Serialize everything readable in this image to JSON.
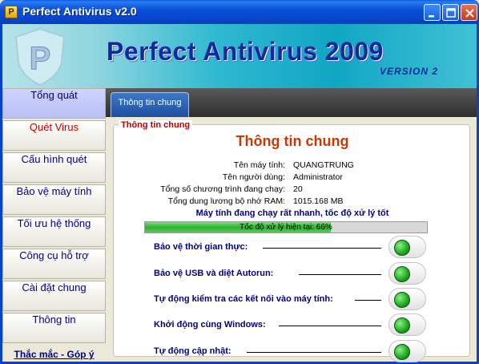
{
  "window": {
    "title": "Perfect Antivirus v2.0",
    "app_icon_letter": "P"
  },
  "banner": {
    "title": "Perfect Antivirus 2009",
    "version": "VERSION 2",
    "logo_letter": "P"
  },
  "sidebar": {
    "items": [
      {
        "label": "Tổng quát",
        "active": true
      },
      {
        "label": "Quét Virus"
      },
      {
        "label": "Cấu hình quét"
      },
      {
        "label": "Bảo vệ máy tính"
      },
      {
        "label": "Tối ưu hệ thống"
      },
      {
        "label": "Công cụ hỗ trợ"
      },
      {
        "label": "Cài đặt chung"
      },
      {
        "label": "Thông tin"
      }
    ],
    "link": "Thắc mắc - Góp ý"
  },
  "tabs": [
    {
      "label": "Thông tin chung",
      "active": true
    }
  ],
  "panel": {
    "legend": "Thông tin chung",
    "heading": "Thông tin chung",
    "info": [
      {
        "label": "Tên máy tính:",
        "value": "QUANGTRUNG"
      },
      {
        "label": "Tên người dùng:",
        "value": "Administrator"
      },
      {
        "label": "Tổng số chương trình đang chạy:",
        "value": "20"
      },
      {
        "label": "Tổng dung lương bộ nhớ RAM:",
        "value": "1015.168 MB"
      }
    ],
    "speed_status": "Máy tính đang chạy rất nhanh, tốc độ xử lý tốt",
    "progress_text": "Tốc độ xử lý hiện tại: 66%",
    "progress_value": 0.66,
    "options": [
      {
        "label": "Bảo vệ thời gian thực:",
        "on": true
      },
      {
        "label": "Bảo vệ USB và diệt Autorun:",
        "on": true
      },
      {
        "label": "Tự động kiểm tra các kết nối vào máy tính:",
        "on": true
      },
      {
        "label": "Khởi động cùng Windows:",
        "on": true
      },
      {
        "label": "Tự động cập nhật:",
        "on": true
      }
    ]
  },
  "colors": {
    "accent_red": "#c00000",
    "heading_orange": "#c83800",
    "nav_blue": "#000080",
    "toggle_on": "#1fb01f"
  }
}
